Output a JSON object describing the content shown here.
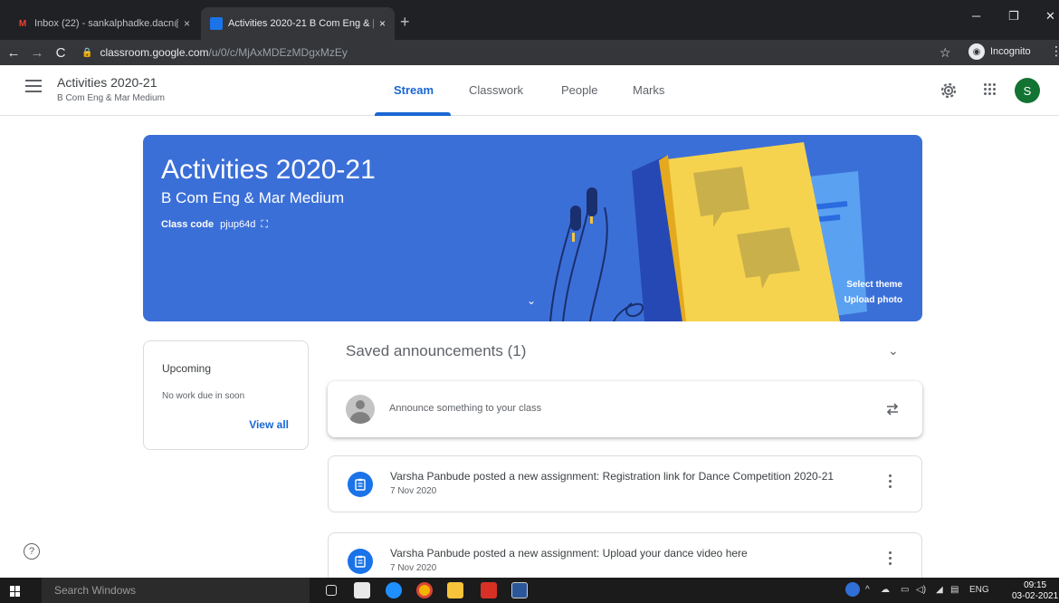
{
  "browser": {
    "tabs": [
      {
        "title": "Inbox (22) - sankalphadke.dacn@",
        "close": "×"
      },
      {
        "title": "Activities 2020-21 B Com Eng & |",
        "close": "×"
      }
    ],
    "new_tab": "+",
    "url_host": "classroom.google.com",
    "url_path": "/u/0/c/MjAxMDEzMDgxMzEy",
    "incognito_label": "Incognito"
  },
  "header": {
    "class_title": "Activities 2020-21",
    "class_subtitle": "B Com Eng & Mar Medium",
    "tabs": [
      {
        "label": "Stream",
        "active": true
      },
      {
        "label": "Classwork",
        "active": false
      },
      {
        "label": "People",
        "active": false
      },
      {
        "label": "Marks",
        "active": false
      }
    ],
    "avatar_letter": "S"
  },
  "banner": {
    "title": "Activities 2020-21",
    "subtitle": "B Com Eng & Mar Medium",
    "class_code_label": "Class code",
    "class_code": "pjup64d",
    "select_theme": "Select theme",
    "upload_photo": "Upload photo"
  },
  "upcoming": {
    "title": "Upcoming",
    "empty_text": "No work due in soon",
    "view_all": "View all"
  },
  "stream": {
    "saved_announcements": "Saved announcements (1)",
    "composer_placeholder": "Announce something to your class",
    "posts": [
      {
        "text": "Varsha Panbude posted a new assignment: Registration link for Dance Competition 2020-21",
        "date": "7 Nov 2020"
      },
      {
        "text": "Varsha Panbude posted a new assignment: Upload your dance video here",
        "date": "7 Nov 2020"
      }
    ]
  },
  "taskbar": {
    "search_placeholder": "Search Windows",
    "language": "ENG",
    "time": "09:15",
    "date": "03-02-2021"
  },
  "colors": {
    "accent": "#1967d2",
    "banner": "#3b6fd8",
    "avatar": "#137333"
  }
}
